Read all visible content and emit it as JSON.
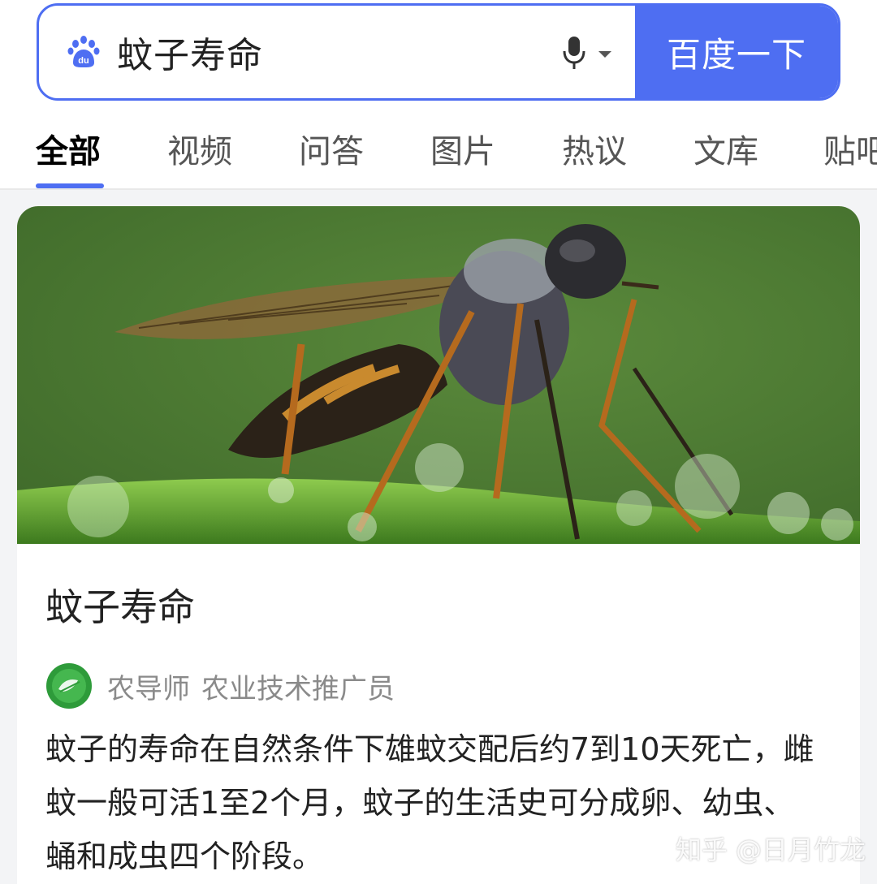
{
  "search": {
    "query": "蚊子寿命",
    "button_label": "百度一下",
    "logo_text": "du"
  },
  "tabs": [
    {
      "label": "全部",
      "active": true
    },
    {
      "label": "视频",
      "active": false
    },
    {
      "label": "问答",
      "active": false
    },
    {
      "label": "图片",
      "active": false
    },
    {
      "label": "热议",
      "active": false
    },
    {
      "label": "文库",
      "active": false
    },
    {
      "label": "贴吧",
      "active": false
    }
  ],
  "result": {
    "title": "蚊子寿命",
    "source_author": "农导师",
    "source_role": "农业技术推广员",
    "snippet": "蚊子的寿命在自然条件下雄蚊交配后约7到10天死亡，雌蚊一般可活1至2个月，蚊子的生活史可分成卵、幼虫、蛹和成虫四个阶段。"
  },
  "watermark": "知乎 @日月竹龙",
  "colors": {
    "accent": "#4e6ef2",
    "background": "#f3f4f6",
    "text_primary": "#222222",
    "text_secondary": "#8a8a8a"
  },
  "icons": {
    "logo": "baidu-paw-icon",
    "voice": "microphone-icon",
    "dropdown": "caret-down-icon",
    "avatar": "agriculture-badge-icon"
  }
}
